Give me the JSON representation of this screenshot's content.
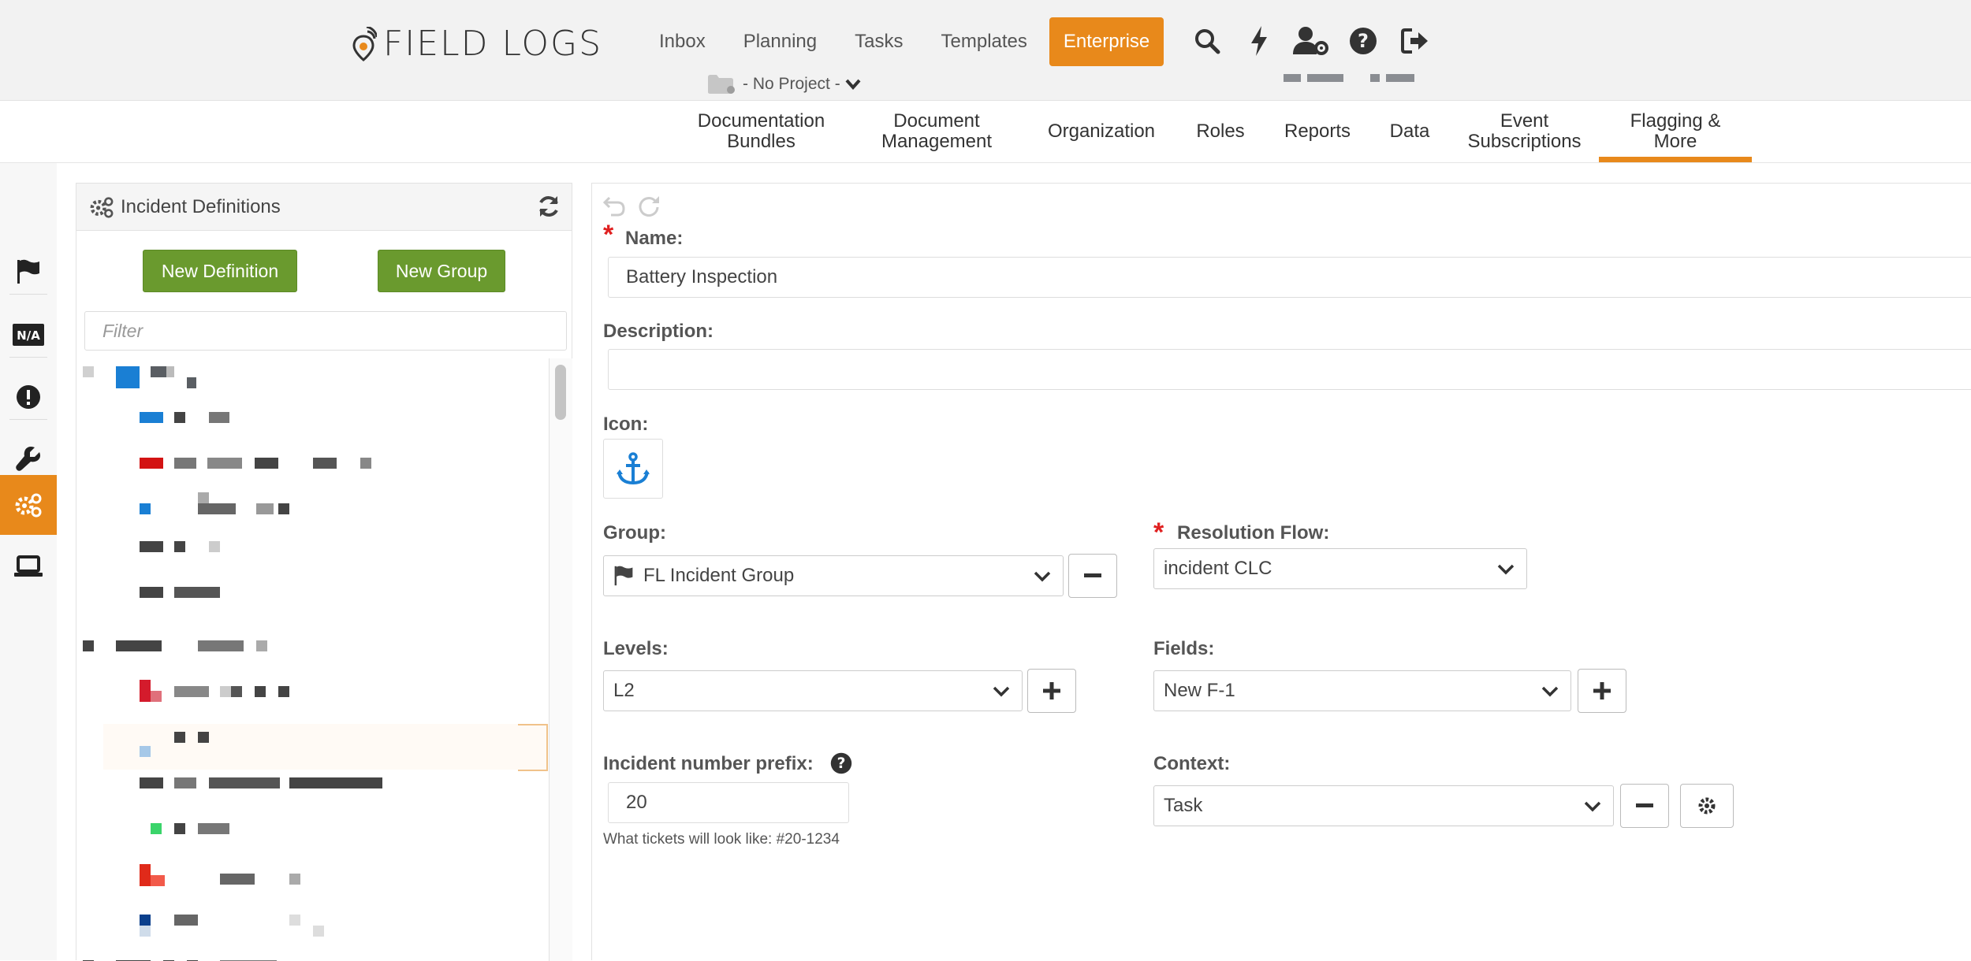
{
  "header": {
    "logo_text": "FIELD LOGS",
    "nav": [
      "Inbox",
      "Planning",
      "Tasks",
      "Templates",
      "Enterprise"
    ],
    "active_nav": "Enterprise",
    "project_selector": "- No Project -",
    "icons": [
      "search-icon",
      "bolt-icon",
      "user-settings-icon",
      "help-icon",
      "logout-icon"
    ]
  },
  "subnav": {
    "items": [
      "Documentation Bundles",
      "Document Management",
      "Organization",
      "Roles",
      "Reports",
      "Data",
      "Event Subscriptions",
      "Flagging & More"
    ],
    "active": "Flagging & More"
  },
  "rail": {
    "icons": [
      "flag-icon",
      "na-icon",
      "exclamation-icon",
      "wrench-icon",
      "gears-icon",
      "laptop-icon"
    ],
    "active": "gears-icon"
  },
  "left_panel": {
    "title": "Incident Definitions",
    "new_definition": "New Definition",
    "new_group": "New Group",
    "filter_placeholder": "Filter"
  },
  "form": {
    "name_label": "Name:",
    "name_value": "Battery Inspection",
    "description_label": "Description:",
    "description_value": "",
    "icon_label": "Icon:",
    "icon": "anchor-icon",
    "group_label": "Group:",
    "group_value": "FL Incident Group",
    "resolution_label": "Resolution Flow:",
    "resolution_value": "incident CLC",
    "levels_label": "Levels:",
    "levels_value": "L2",
    "fields_label": "Fields:",
    "fields_value": "New F-1",
    "prefix_label": "Incident number prefix:",
    "prefix_value": "20",
    "prefix_hint": "What tickets will look like: #20-1234",
    "context_label": "Context:",
    "context_value": "Task"
  },
  "colors": {
    "accent": "#e8891b",
    "green_button": "#6a9a2e",
    "required": "#e02020",
    "icon_blue": "#1a7fd4"
  }
}
